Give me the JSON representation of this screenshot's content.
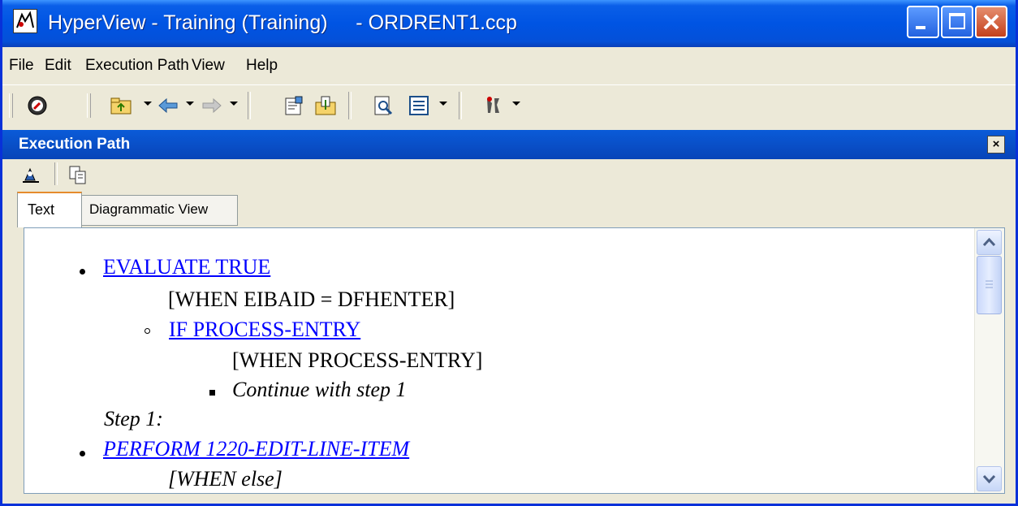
{
  "window": {
    "title": "HyperView - Training (Training)     - ORDRENT1.ccp",
    "controls": {
      "minimize": "minimize",
      "maximize": "maximize",
      "close": "close"
    }
  },
  "menu": [
    "File",
    "Edit",
    "Execution Path",
    "View",
    "Help"
  ],
  "toolbar": {
    "icons": [
      "navigator-icon",
      "open-folder-icon",
      "back-arrow-icon",
      "forward-arrow-icon",
      "properties-icon",
      "export-icon",
      "preview-icon",
      "list-view-icon",
      "tools-icon"
    ]
  },
  "panel": {
    "title": "Execution Path",
    "close_glyph": "×",
    "tools": [
      "find-icon",
      "copy-icon"
    ],
    "tabs": [
      "Text",
      "Diagrammatic View"
    ],
    "active_tab": "Text"
  },
  "content": {
    "lines": [
      "EVALUATE TRUE",
      "[WHEN EIBAID = DFHENTER]",
      "IF PROCESS-ENTRY",
      "[WHEN PROCESS-ENTRY]",
      "Continue with step 1",
      "Step 1:",
      "PERFORM 1220-EDIT-LINE-ITEM",
      "[WHEN else]"
    ]
  },
  "colors": {
    "titlebar": "#0054e3",
    "panel_titlebar": "#0a5bd8",
    "link": "#0000ff",
    "chrome": "#ece9d8",
    "tab_highlight": "#e68b2c"
  }
}
